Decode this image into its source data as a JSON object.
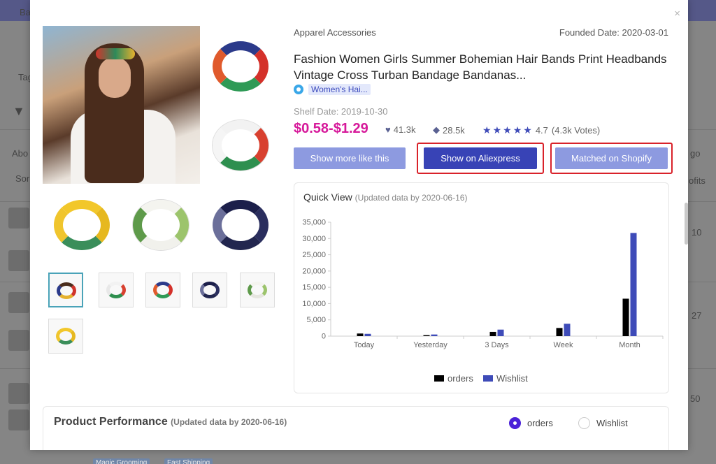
{
  "background": {
    "left_labels": [
      "Ba",
      "Tag",
      "Abo",
      "Sor"
    ],
    "right_labels": [
      "go",
      "ofits"
    ],
    "values": [
      "10",
      "27",
      "50"
    ],
    "badges": [
      "Magic Grooming",
      "Fast Shipping"
    ]
  },
  "product": {
    "category": "Apparel Accessories",
    "founded_date": "Founded Date: 2020-03-01",
    "title": "Fashion Women Girls Summer Bohemian Hair Bands Print Headbands Vintage Cross Turban Bandage Bandanas...",
    "tag": "Women's Hai...",
    "shelf_date": "Shelf Date: 2019-10-30",
    "price": "$0.58-$1.29",
    "likes": "41.3k",
    "saves": "28.5k",
    "rating": "4.7",
    "votes": "(4.3k Votes)",
    "rating_value": 4.7,
    "rating_max": 5
  },
  "buttons": {
    "more": "Show more like this",
    "aliexpress": "Show on Aliexpress",
    "shopify": "Matched on Shopify"
  },
  "close_label": "×",
  "quick_view": {
    "title": "Quick View",
    "updated": "(Updated data by 2020-06-16)"
  },
  "chart_data": {
    "type": "bar",
    "categories": [
      "Today",
      "Yesterday",
      "3 Days",
      "Week",
      "Month"
    ],
    "series": [
      {
        "name": "orders",
        "values": [
          800,
          300,
          1300,
          2500,
          11500
        ],
        "color": "#000000"
      },
      {
        "name": "Wishlist",
        "values": [
          700,
          500,
          2000,
          3800,
          31700
        ],
        "color": "#3e4bb8"
      }
    ],
    "yticks": [
      "0",
      "5,000",
      "10,000",
      "15,000",
      "20,000",
      "25,000",
      "30,000",
      "35,000"
    ],
    "ylim": [
      0,
      35000
    ],
    "legend": "bottom-center",
    "grid": false
  },
  "performance": {
    "title": "Product Performance",
    "updated": "(Updated data by 2020-06-16)",
    "options": [
      "orders",
      "Wishlist"
    ],
    "selected": "orders"
  },
  "colors": {
    "accent": "#3843b6",
    "light_button": "#8d9ae0",
    "price": "#d6199a",
    "highlight": "#d9222a"
  }
}
